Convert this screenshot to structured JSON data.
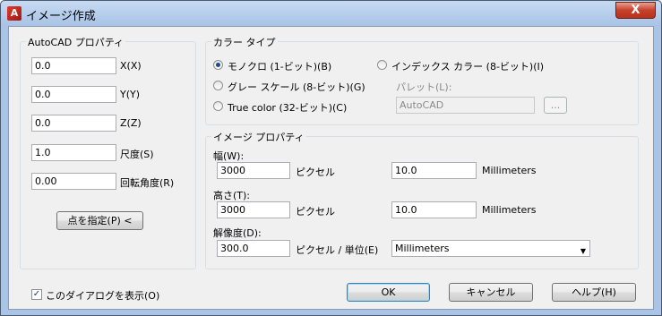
{
  "window": {
    "title": "イメージ作成",
    "close_glyph": "X",
    "app_icon_glyph": "A"
  },
  "autocad_props": {
    "group_label": "AutoCAD プロパティ",
    "x": {
      "value": "0.0",
      "label": "X(X)"
    },
    "y": {
      "value": "0.0",
      "label": "Y(Y)"
    },
    "z": {
      "value": "0.0",
      "label": "Z(Z)"
    },
    "scale": {
      "value": "1.0",
      "label": "尺度(S)"
    },
    "rotation": {
      "value": "0.00",
      "label": "回転角度(R)"
    },
    "pick_point_button": "点を指定(P) <"
  },
  "color_type": {
    "group_label": "カラー タイプ",
    "monochrome": "モノクロ (1-ビット)(B)",
    "grayscale": "グレー スケール (8-ビット)(G)",
    "truecolor": "True color (32-ビット)(C)",
    "indexed": "インデックス カラー (8-ビット)(I)",
    "palette_label": "パレット(L):",
    "palette_value": "AutoCAD",
    "palette_browse": "..."
  },
  "image_props": {
    "group_label": "イメージ プロパティ",
    "width_label": "幅(W):",
    "width_px": "3000",
    "width_unit_px": "ピクセル",
    "width_mm": "10.0",
    "width_unit": "Millimeters",
    "height_label": "高さ(T):",
    "height_px": "3000",
    "height_unit_px": "ピクセル",
    "height_mm": "10.0",
    "height_unit": "Millimeters",
    "resolution_label": "解像度(D):",
    "resolution_value": "300.0",
    "resolution_unit_label": "ピクセル / 単位(E)",
    "resolution_unit_select": "Millimeters"
  },
  "footer": {
    "show_dialog_label": "このダイアログを表示(O)",
    "ok": "OK",
    "cancel": "キャンセル",
    "help": "ヘルプ(H)"
  },
  "colors": {
    "titlebar": "#a8c3e6",
    "close": "#c7402a",
    "client": "#f0f0f0"
  }
}
